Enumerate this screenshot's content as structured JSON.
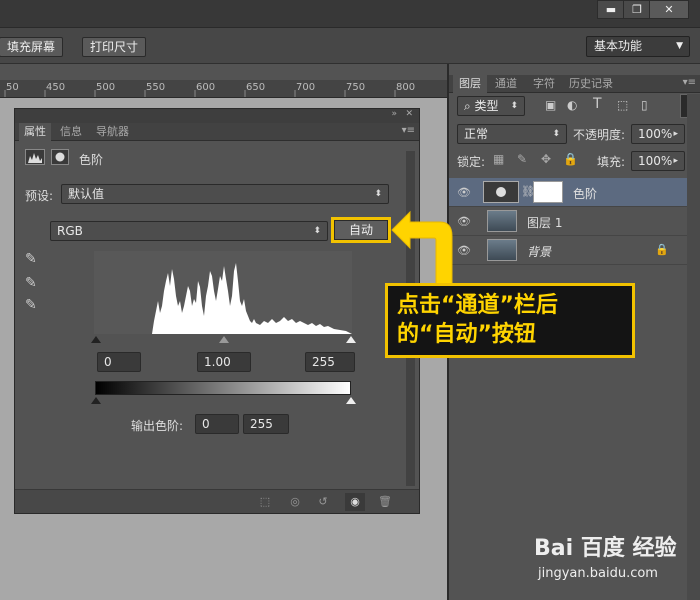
{
  "window_controls": {
    "minimize": "▬",
    "restore": "❐",
    "close": "✕"
  },
  "options_bar": {
    "fill_screen": "填充屏幕",
    "print_size": "打印尺寸",
    "workspace": "基本功能"
  },
  "ruler": {
    "ticks": [
      "50",
      "450",
      "500",
      "550",
      "600",
      "650",
      "700",
      "750",
      "800"
    ]
  },
  "properties": {
    "tabs": [
      "属性",
      "信息",
      "导航器"
    ],
    "title": "色阶",
    "preset_label": "预设:",
    "preset_value": "默认值",
    "channel": "RGB",
    "auto_button": "自动",
    "input_black": "0",
    "input_gamma": "1.00",
    "input_white": "255",
    "output_label": "输出色阶:",
    "output_black": "0",
    "output_white": "255"
  },
  "layers_panel": {
    "tabs": [
      "图层",
      "通道",
      "字符",
      "历史记录"
    ],
    "filter_label": "类型",
    "blend_mode": "正常",
    "opacity_label": "不透明度:",
    "opacity_value": "100%",
    "lock_label": "锁定:",
    "fill_label": "填充:",
    "fill_value": "100%",
    "layers": [
      {
        "name": "色阶"
      },
      {
        "name": "图层 1"
      },
      {
        "name": "背景"
      }
    ]
  },
  "callout": {
    "line1": "点击“通道”栏后",
    "line2": "的“自动”按钮"
  },
  "watermark": {
    "brand": "Bai 百度 经验",
    "url": "jingyan.baidu.com"
  },
  "colors": {
    "callout_border": "#f2c200",
    "callout_text": "#ffd400",
    "selected_layer": "#5c6a80"
  }
}
